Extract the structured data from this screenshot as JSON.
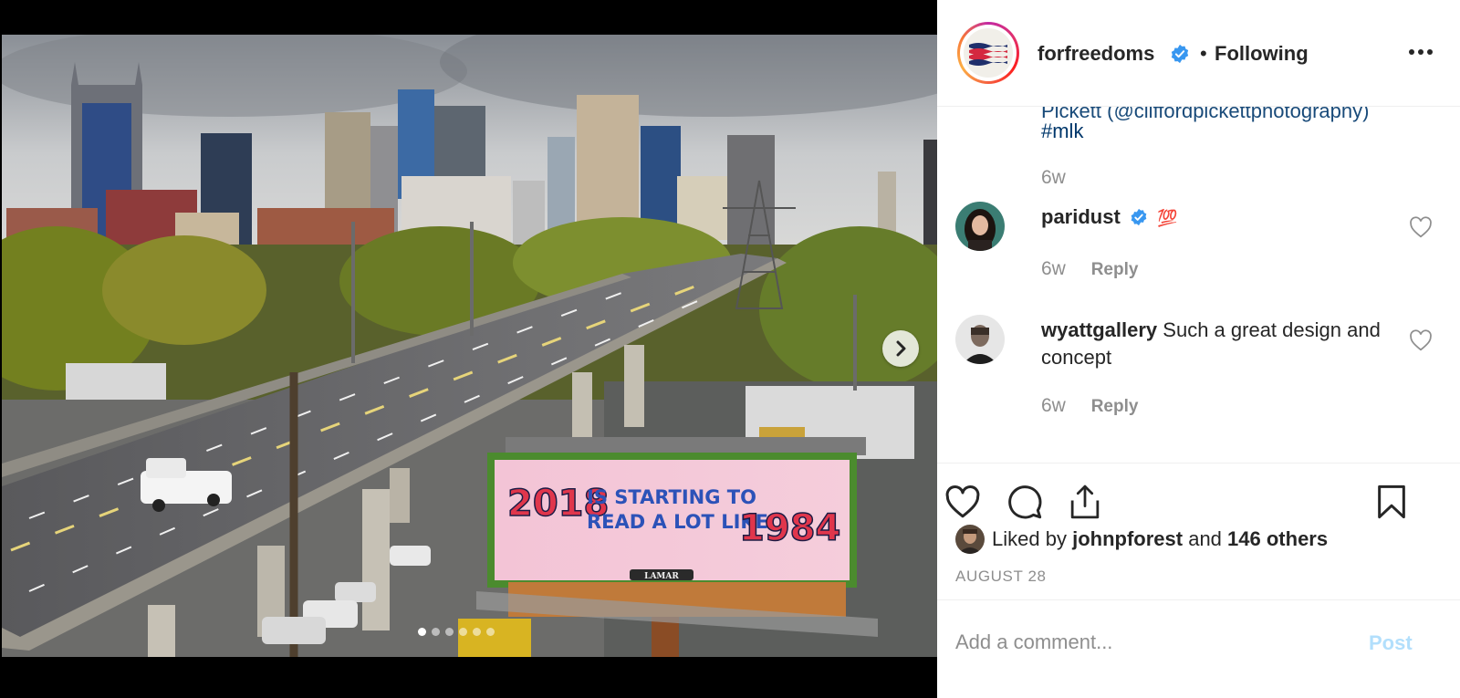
{
  "post": {
    "username": "forfreedoms",
    "follow_separator": "•",
    "follow_status": "Following",
    "more_options": "options-icon"
  },
  "media": {
    "carousel_total": 6,
    "carousel_active": 1,
    "billboard": {
      "year_left": "2018",
      "line1": "IS STARTING TO",
      "line2": "READ A LOT LIKE",
      "year_right": "1984",
      "brand": "LAMAR"
    }
  },
  "caption": {
    "truncated_line": "Pickett (@cliffordpickettphotography)",
    "hashtag": "#mlk",
    "time": "6w"
  },
  "comments": [
    {
      "user": "paridust",
      "text": "",
      "emoji": "💯",
      "verified": true,
      "time": "6w",
      "reply": "Reply"
    },
    {
      "user": "wyattgallery",
      "text": "Such a great design and concept",
      "emoji": "",
      "verified": false,
      "time": "6w",
      "reply": "Reply"
    }
  ],
  "likes": {
    "prefix": "Liked by",
    "user": "johnpforest",
    "joiner": "and",
    "others": "146 others"
  },
  "date": "AUGUST 28",
  "composer": {
    "placeholder": "Add a comment...",
    "post_label": "Post"
  },
  "colors": {
    "link": "#00376b",
    "muted": "#8e8e8e",
    "verified": "#3897f0",
    "post_disabled": "#b2dffc"
  }
}
